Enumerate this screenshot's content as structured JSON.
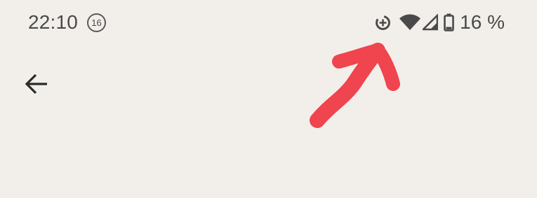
{
  "status_bar": {
    "time": "22:10",
    "notification_count": "16",
    "battery_percent": "16 %",
    "icons": [
      "data-saver-icon",
      "wifi-icon",
      "cell-signal-icon",
      "battery-icon"
    ]
  },
  "toolbar": {
    "back_icon": "arrow-back-icon"
  },
  "annotation": {
    "color": "#f0444f",
    "icon": "red-arrow"
  },
  "colors": {
    "background": "#f2efea",
    "status_text": "#4a4a4a",
    "icon": "#444444"
  }
}
